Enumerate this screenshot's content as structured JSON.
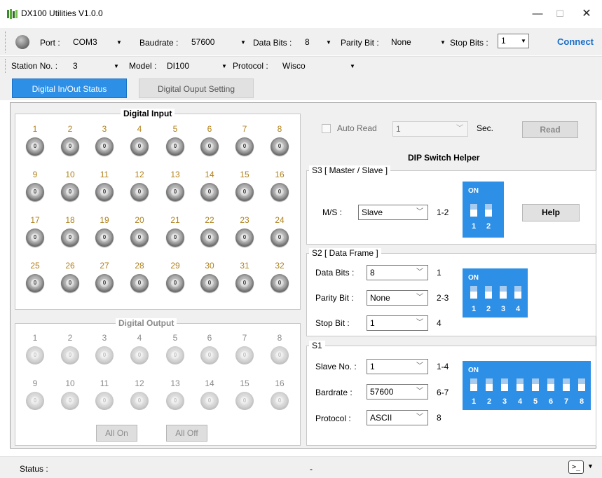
{
  "window": {
    "title": "DX100 Utilities V1.0.0",
    "minimize": "—",
    "maximize": "☐",
    "close": "✕"
  },
  "toolbar": {
    "port_label": "Port :",
    "port_value": "COM3",
    "baudrate_label": "Baudrate :",
    "baudrate_value": "57600",
    "databits_label": "Data Bits :",
    "databits_value": "8",
    "parity_label": "Parity Bit :",
    "parity_value": "None",
    "stopbits_label": "Stop Bits :",
    "stopbits_value": "1",
    "connect_label": "Connect",
    "station_label": "Station No. :",
    "station_value": "3",
    "model_label": "Model :",
    "model_value": "DI100",
    "protocol_label": "Protocol :",
    "protocol_value": "Wisco"
  },
  "tabs": {
    "active": "Digital In/Out Status",
    "other": "Digital Ouput Setting"
  },
  "digital_input": {
    "title": "Digital Input",
    "rows": [
      [
        "1",
        "2",
        "3",
        "4",
        "5",
        "6",
        "7",
        "8"
      ],
      [
        "9",
        "10",
        "11",
        "12",
        "13",
        "14",
        "15",
        "16"
      ],
      [
        "17",
        "18",
        "19",
        "20",
        "21",
        "22",
        "23",
        "24"
      ],
      [
        "25",
        "26",
        "27",
        "28",
        "29",
        "30",
        "31",
        "32"
      ]
    ],
    "state": "0"
  },
  "digital_output": {
    "title": "Digital Output",
    "rows": [
      [
        "1",
        "2",
        "3",
        "4",
        "5",
        "6",
        "7",
        "8"
      ],
      [
        "9",
        "10",
        "11",
        "12",
        "13",
        "14",
        "15",
        "16"
      ]
    ],
    "state": "0",
    "all_on": "All On",
    "all_off": "All Off"
  },
  "auto_read": {
    "label": "Auto Read",
    "interval": "1",
    "unit": "Sec.",
    "read_button": "Read"
  },
  "dip_helper": {
    "title": "DIP Switch Helper",
    "on_label": "ON",
    "s3": {
      "title": "S3 [ Master / Slave ]",
      "ms_label": "M/S :",
      "ms_value": "Slave",
      "ms_range": "1-2",
      "help_button": "Help",
      "switch_count": "2"
    },
    "s2": {
      "title": "S2 [ Data Frame ]",
      "databits_label": "Data Bits :",
      "databits_value": "8",
      "databits_range": "1",
      "parity_label": "Parity Bit :",
      "parity_value": "None",
      "parity_range": "2-3",
      "stopbit_label": "Stop Bit :",
      "stopbit_value": "1",
      "stopbit_range": "4",
      "switch_count": "4"
    },
    "s1": {
      "title": "S1",
      "slave_label": "Slave No. :",
      "slave_value": "1",
      "slave_range": "1-4",
      "bardrate_label": "Bardrate :",
      "bardrate_value": "57600",
      "bardrate_range": "6-7",
      "protocol_label": "Protocol :",
      "protocol_value": "ASCII",
      "protocol_range": "8",
      "switch_count": "8"
    }
  },
  "status": {
    "label": "Status :",
    "value": "-",
    "console_icon": "terminal-icon"
  }
}
